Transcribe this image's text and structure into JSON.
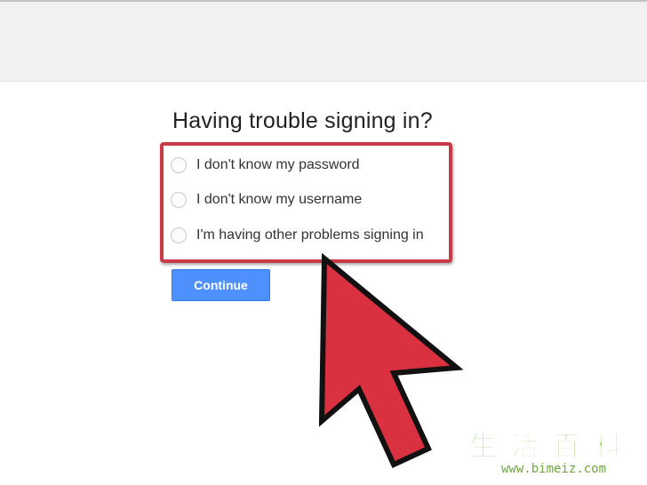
{
  "page": {
    "title": "Having trouble signing in?"
  },
  "options": [
    {
      "label": "I don't know my password",
      "selected": false
    },
    {
      "label": "I don't know my username",
      "selected": false
    },
    {
      "label": "I'm having other problems signing in",
      "selected": false
    }
  ],
  "actions": {
    "continue_label": "Continue"
  },
  "annotation": {
    "highlight_color": "#c83a45",
    "arrow_color": "#d9313f"
  },
  "watermark": {
    "glyphs": "生活百科",
    "url": "www.bimeiz.com"
  },
  "colors": {
    "primary_button": "#4d90fe",
    "top_bar": "#f1f1f1"
  }
}
